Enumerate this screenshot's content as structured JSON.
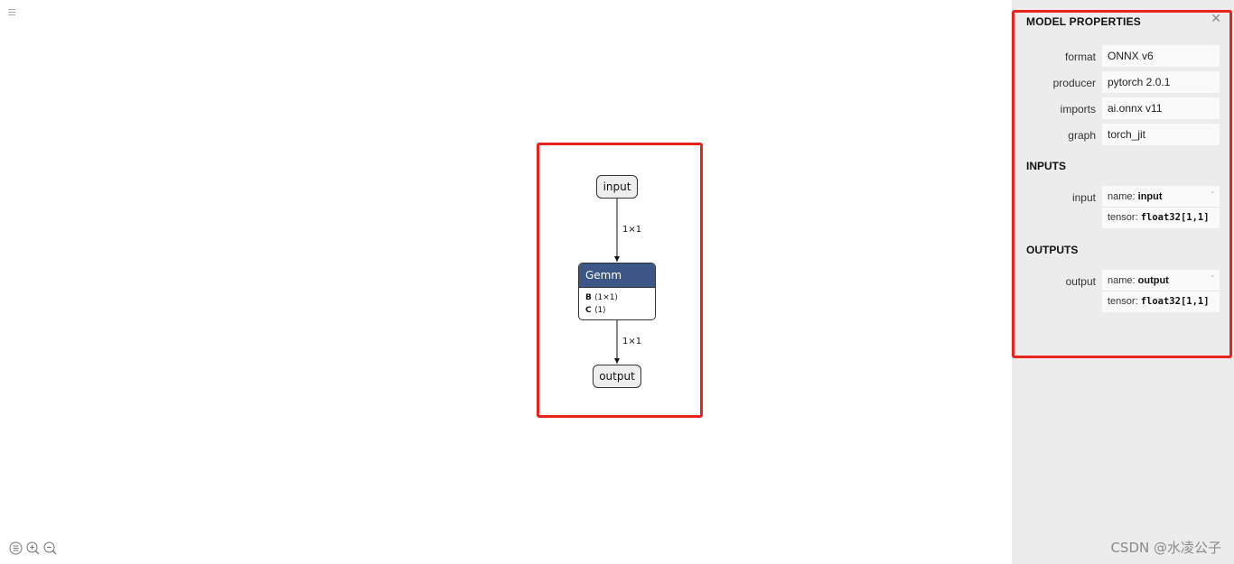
{
  "graph": {
    "input_node": "input",
    "output_node": "output",
    "op": {
      "name": "Gemm",
      "attrs": [
        {
          "key": "B",
          "value": "⟨1×1⟩"
        },
        {
          "key": "C",
          "value": "⟨1⟩"
        }
      ]
    },
    "edge_in_label": "1×1",
    "edge_out_label": "1×1"
  },
  "sidebar": {
    "title": "MODEL PROPERTIES",
    "close": "✕",
    "properties": [
      {
        "name": "format",
        "value": "ONNX v6"
      },
      {
        "name": "producer",
        "value": "pytorch 2.0.1"
      },
      {
        "name": "imports",
        "value": "ai.onnx v11"
      },
      {
        "name": "graph",
        "value": "torch_jit"
      }
    ],
    "inputs_title": "INPUTS",
    "inputs": [
      {
        "label": "input",
        "name_prefix": "name:",
        "name": "input",
        "tensor_prefix": "tensor:",
        "tensor": "float32[1,1]",
        "dash": "-"
      }
    ],
    "outputs_title": "OUTPUTS",
    "outputs": [
      {
        "label": "output",
        "name_prefix": "name:",
        "name": "output",
        "tensor_prefix": "tensor:",
        "tensor": "float32[1,1]",
        "dash": "-"
      }
    ]
  },
  "watermark": "CSDN @水凌公子",
  "icons": [
    "menu-icon",
    "list-icon",
    "zoom-in-icon",
    "zoom-out-icon",
    "close-icon"
  ],
  "colors": {
    "op_header": "#3b5687",
    "highlight": "#e8231b",
    "sidebar_bg": "#ececec"
  }
}
